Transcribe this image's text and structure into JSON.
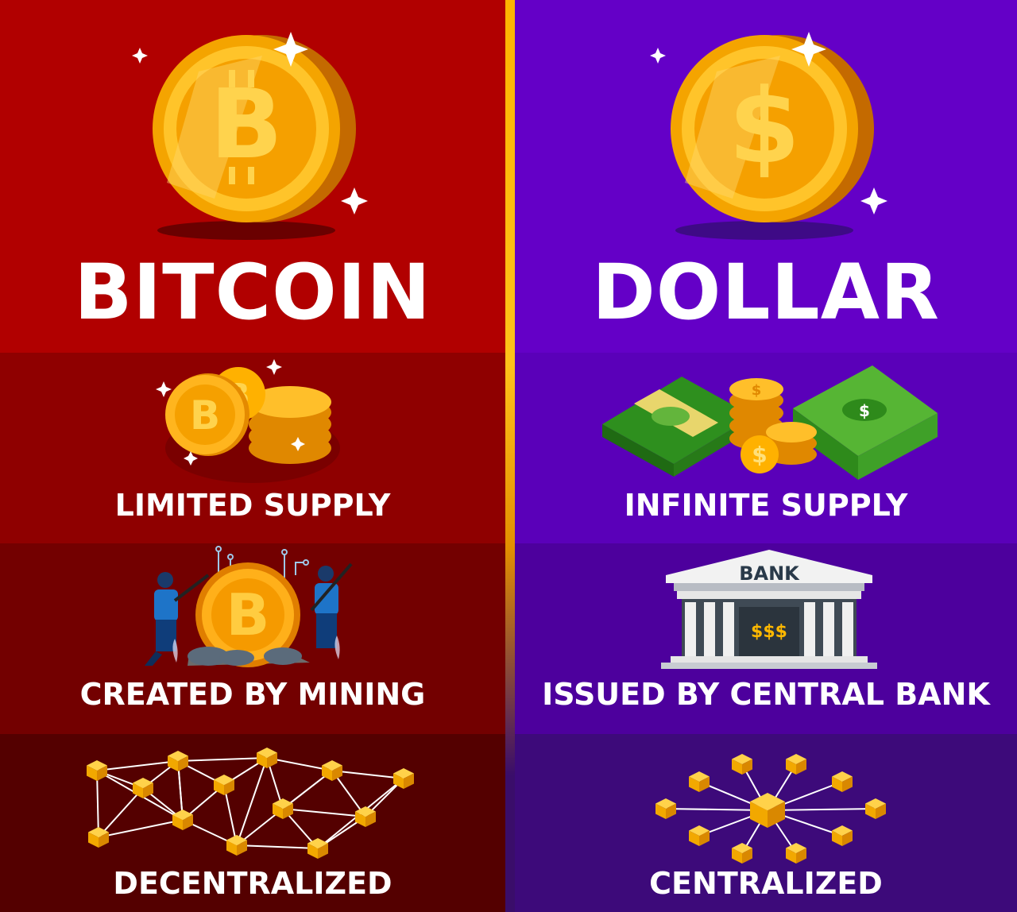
{
  "bitcoin": {
    "title": "BITCOIN",
    "features": [
      {
        "label": "LIMITED SUPPLY",
        "icon": "coin-stack-icon"
      },
      {
        "label": "CREATED BY MINING",
        "icon": "miners-icon"
      },
      {
        "label": "DECENTRALIZED",
        "icon": "decentralized-network-icon"
      }
    ],
    "coin_symbol": "B"
  },
  "dollar": {
    "title": "DOLLAR",
    "features": [
      {
        "label": "INFINITE SUPPLY",
        "icon": "cash-and-coins-icon"
      },
      {
        "label": "ISSUED BY CENTRAL BANK",
        "icon": "bank-icon"
      },
      {
        "label": "CENTRALIZED",
        "icon": "centralized-network-icon"
      }
    ],
    "coin_symbol": "$",
    "bank_sign": "BANK",
    "bank_vault": "$$$"
  },
  "colors": {
    "bitcoin_red": "#b10000",
    "dollar_purple": "#6400c7",
    "gold": "#ffb400"
  }
}
